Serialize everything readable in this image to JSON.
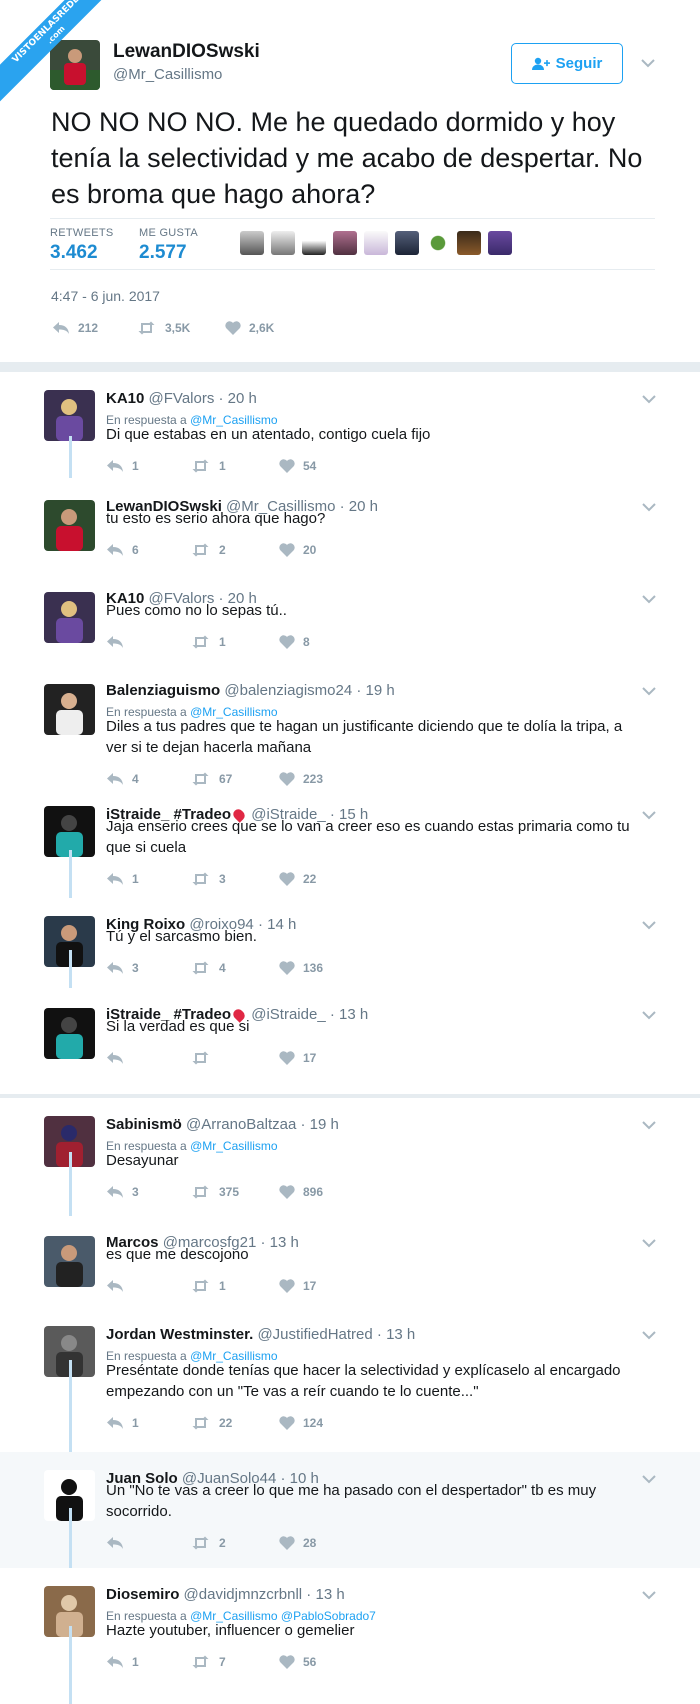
{
  "watermark": {
    "line1": "VISTOENLASREDES",
    "line2": ".com"
  },
  "main_tweet": {
    "name": "LewanDIOSwski",
    "handle": "@Mr_Casillismo",
    "follow_label": "Seguir",
    "text": "NO NO NO NO. Me he quedado dormido y hoy tenía la selectividad y me acabo de despertar. No es broma que hago ahora?",
    "retweets_label": "RETWEETS",
    "retweets_value": "3.462",
    "likes_label": "ME GUSTA",
    "likes_value": "2.577",
    "timestamp": "4:47 - 6 jun. 2017",
    "actions": {
      "replies": "212",
      "retweets": "3,5K",
      "likes": "2,6K"
    }
  },
  "replies": [
    {
      "name": "KA10",
      "handle": "@FValors",
      "time": "20 h",
      "in_reply_label": "En respuesta a",
      "in_reply_to": "@Mr_Casillismo",
      "text": "Di que estabas en un atentado, contigo cuela fijo",
      "replies": "1",
      "retweets": "1",
      "likes": "54"
    },
    {
      "name": "LewanDIOSwski",
      "handle": "@Mr_Casillismo",
      "time": "20 h",
      "text": "tu esto es serio ahora que hago?",
      "replies": "6",
      "retweets": "2",
      "likes": "20"
    },
    {
      "name": "KA10",
      "handle": "@FValors",
      "time": "20 h",
      "text": "Pues como no lo sepas tú..",
      "replies": "",
      "retweets": "1",
      "likes": "8"
    },
    {
      "name": "Balenziaguismo",
      "handle": "@balenziagismo24",
      "time": "19 h",
      "in_reply_label": "En respuesta a",
      "in_reply_to": "@Mr_Casillismo",
      "text": "Diles a tus padres que te hagan un justificante diciendo que te dolía la tripa, a ver si te dejan hacerla mañana",
      "replies": "4",
      "retweets": "67",
      "likes": "223"
    },
    {
      "name": "iStraide_ #Tradeo",
      "handle": "@iStraide_",
      "time": "15 h",
      "text": "Jaja enserio crees que se lo van a creer eso es cuando estas primaria como tu que si cuela",
      "replies": "1",
      "retweets": "3",
      "likes": "22"
    },
    {
      "name": "King Roixo",
      "handle": "@roixo94",
      "time": "14 h",
      "text": "Tú y el sarcasmo bien.",
      "replies": "3",
      "retweets": "4",
      "likes": "136"
    },
    {
      "name": "iStraide_ #Tradeo",
      "handle": "@iStraide_",
      "time": "13 h",
      "text": "Si la verdad es que si",
      "replies": "",
      "retweets": "",
      "likes": "17"
    },
    {
      "name": "Sabinismö",
      "handle": "@ArranoBaltzaa",
      "time": "19 h",
      "in_reply_label": "En respuesta a",
      "in_reply_to": "@Mr_Casillismo",
      "text": "Desayunar",
      "replies": "3",
      "retweets": "375",
      "likes": "896"
    },
    {
      "name": "Marcos",
      "handle": "@marcosfg21",
      "time": "13 h",
      "text": "es que me descojono",
      "replies": "",
      "retweets": "1",
      "likes": "17"
    },
    {
      "name": "Jordan Westminster.",
      "handle": "@JustifiedHatred",
      "time": "13 h",
      "in_reply_label": "En respuesta a",
      "in_reply_to": "@Mr_Casillismo",
      "text": "Preséntate donde tenías que hacer la selectividad y explícaselo al encargado empezando con un \"Te vas a reír cuando te lo cuente...\"",
      "replies": "1",
      "retweets": "22",
      "likes": "124"
    },
    {
      "name": "Juan Solo",
      "handle": "@JuanSolo44",
      "time": "10 h",
      "text": "Un \"No te vas a creer lo que me ha pasado con el despertador\" tb es muy socorrido.",
      "replies": "",
      "retweets": "2",
      "likes": "28"
    },
    {
      "name": "Diosemiro",
      "handle": "@davidjmnzcrbnll",
      "time": "13 h",
      "in_reply_label": "En respuesta a",
      "in_reply_to": "@Mr_Casillismo @PabloSobrado7",
      "text": "Hazte youtuber, influencer o gemelier",
      "replies": "1",
      "retweets": "7",
      "likes": "56"
    }
  ],
  "colors": {
    "accent": "#1da1f2",
    "secondary_text": "#657786",
    "thread_line": "#c4e0f3",
    "highlight_bg": "#f5f8fa"
  }
}
